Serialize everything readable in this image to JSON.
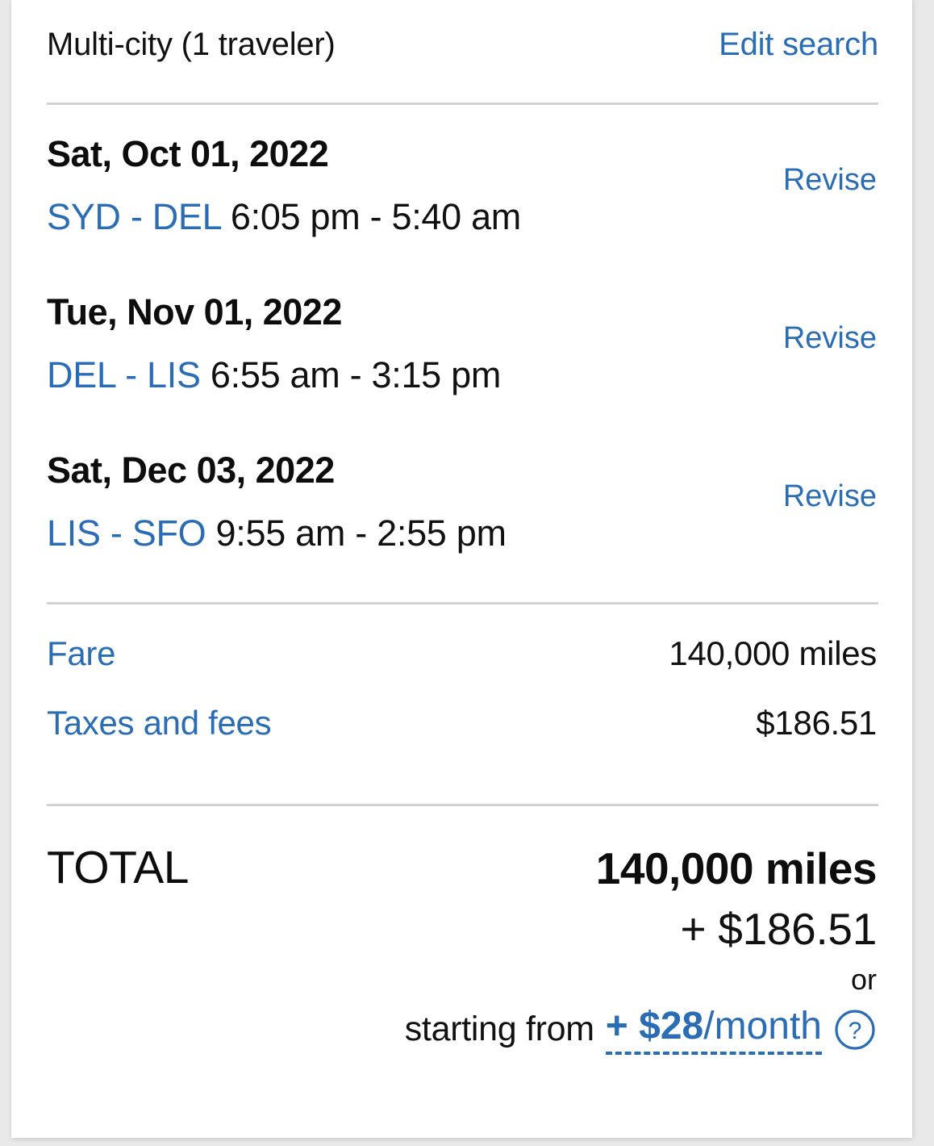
{
  "header": {
    "trip_type": "Multi-city (1 traveler)",
    "edit_search_label": "Edit search"
  },
  "segments": [
    {
      "date": "Sat, Oct 01, 2022",
      "airports": "SYD - DEL",
      "times": "6:05 pm - 5:40 am",
      "revise_label": "Revise"
    },
    {
      "date": "Tue, Nov 01, 2022",
      "airports": "DEL - LIS",
      "times": "6:55 am - 3:15 pm",
      "revise_label": "Revise"
    },
    {
      "date": "Sat, Dec 03, 2022",
      "airports": "LIS - SFO",
      "times": "9:55 am - 2:55 pm",
      "revise_label": "Revise"
    }
  ],
  "price_rows": [
    {
      "label": "Fare",
      "value": "140,000 miles"
    },
    {
      "label": "Taxes and fees",
      "value": "$186.51"
    }
  ],
  "total": {
    "label": "TOTAL",
    "miles": "140,000 miles",
    "cash": "+ $186.51",
    "or_label": "or",
    "starting_from_label": "starting from",
    "monthly_amount": "+ $28",
    "monthly_period": "/month",
    "help_icon": "question-mark-circle-icon"
  },
  "colors": {
    "link_blue": "#2a6db5",
    "text_black": "#111111",
    "divider_gray": "#d2d2d2",
    "card_background": "#ffffff",
    "page_background": "#e9e9ea"
  }
}
